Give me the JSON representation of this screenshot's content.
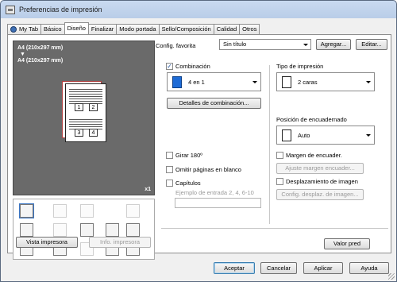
{
  "window": {
    "title": "Preferencias de impresión"
  },
  "tabs": [
    {
      "label": "My Tab",
      "active": false
    },
    {
      "label": "Básico",
      "active": false
    },
    {
      "label": "Diseño",
      "active": true
    },
    {
      "label": "Finalizar",
      "active": false
    },
    {
      "label": "Modo portada",
      "active": false
    },
    {
      "label": "Sello/Composición",
      "active": false
    },
    {
      "label": "Calidad",
      "active": false
    },
    {
      "label": "Otros",
      "active": false
    }
  ],
  "config": {
    "label": "Config. favorita",
    "value": "Sin título",
    "add_button": "Agregar...",
    "edit_button": "Editar..."
  },
  "preview": {
    "paper_line1": "A4 (210x297 mm)",
    "arrow": "▼",
    "paper_line2": "A4 (210x297 mm)",
    "copies": "x1",
    "page_numbers": [
      "1",
      "2",
      "3",
      "4"
    ]
  },
  "preview_buttons": {
    "printer_view": "Vista impresora",
    "printer_info": "Info. impresora"
  },
  "combination": {
    "checkbox_label": "Combinación",
    "checked": "✓",
    "value": "4 en 1",
    "details_button": "Detalles de combinación..."
  },
  "print_type": {
    "label": "Tipo de impresión",
    "value": "2 caras"
  },
  "binding": {
    "label": "Posición de encuadernado",
    "value": "Auto"
  },
  "options": {
    "rotate": "Girar 180º",
    "skip_blank": "Omitir páginas en blanco",
    "chapters": "Capítulos",
    "chapters_hint": "Ejemplo de entrada 2, 4, 6-10",
    "binding_margin": "Margen de encuader.",
    "adjust_margin": "Ajuste margen encuader...",
    "image_shift": "Desplazamiento de imagen",
    "config_shift": "Config. desplaz. de imagen..."
  },
  "default_button": "Valor pred",
  "bottom_buttons": {
    "accept": "Aceptar",
    "cancel": "Cancelar",
    "apply": "Aplicar",
    "help": "Ayuda"
  }
}
